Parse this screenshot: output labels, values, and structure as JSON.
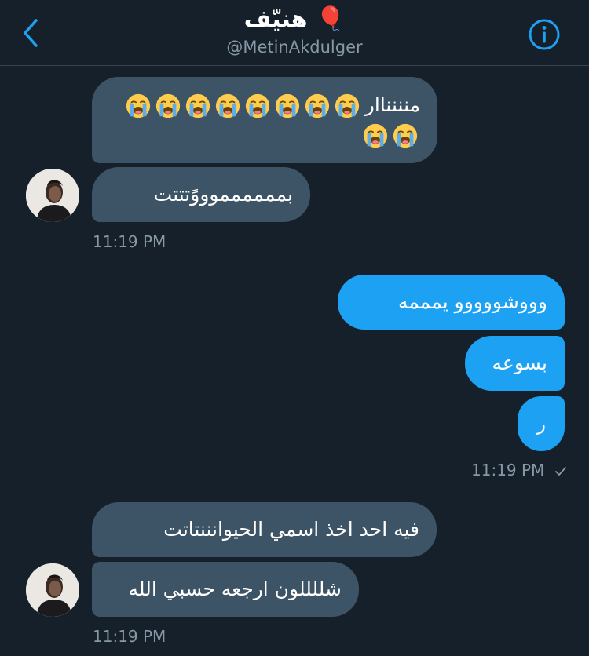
{
  "header": {
    "title": "هنيّف 🎈",
    "handle": "@MetinAkdulger"
  },
  "messages": [
    {
      "direction": "in",
      "text": "منننناار",
      "emoji": "😭",
      "emoji_count": 10
    },
    {
      "direction": "in",
      "text": "بمممممموووًتتتت"
    },
    {
      "direction": "in_time",
      "text": "11:19 PM"
    },
    {
      "direction": "out",
      "text": "وووشووووو يمممه"
    },
    {
      "direction": "out",
      "text": "بسوعه"
    },
    {
      "direction": "out",
      "text": "ر"
    },
    {
      "direction": "out_time",
      "text": "11:19 PM"
    },
    {
      "direction": "in",
      "text": "فيه احد اخذ اسمي الحيوانننتاتت"
    },
    {
      "direction": "in",
      "text": "شللللون ارجعه حسبي الله"
    },
    {
      "direction": "in_time",
      "text": "11:19 PM"
    }
  ],
  "icons": {
    "back": "chevron-left-icon",
    "info": "info-icon",
    "read_receipt": "check-icon"
  },
  "colors": {
    "background": "#15202b",
    "incoming_bubble": "#3d5466",
    "outgoing_bubble": "#1da1f2",
    "accent": "#1da1f2",
    "secondary_text": "#8899a6",
    "divider": "#38444d"
  }
}
